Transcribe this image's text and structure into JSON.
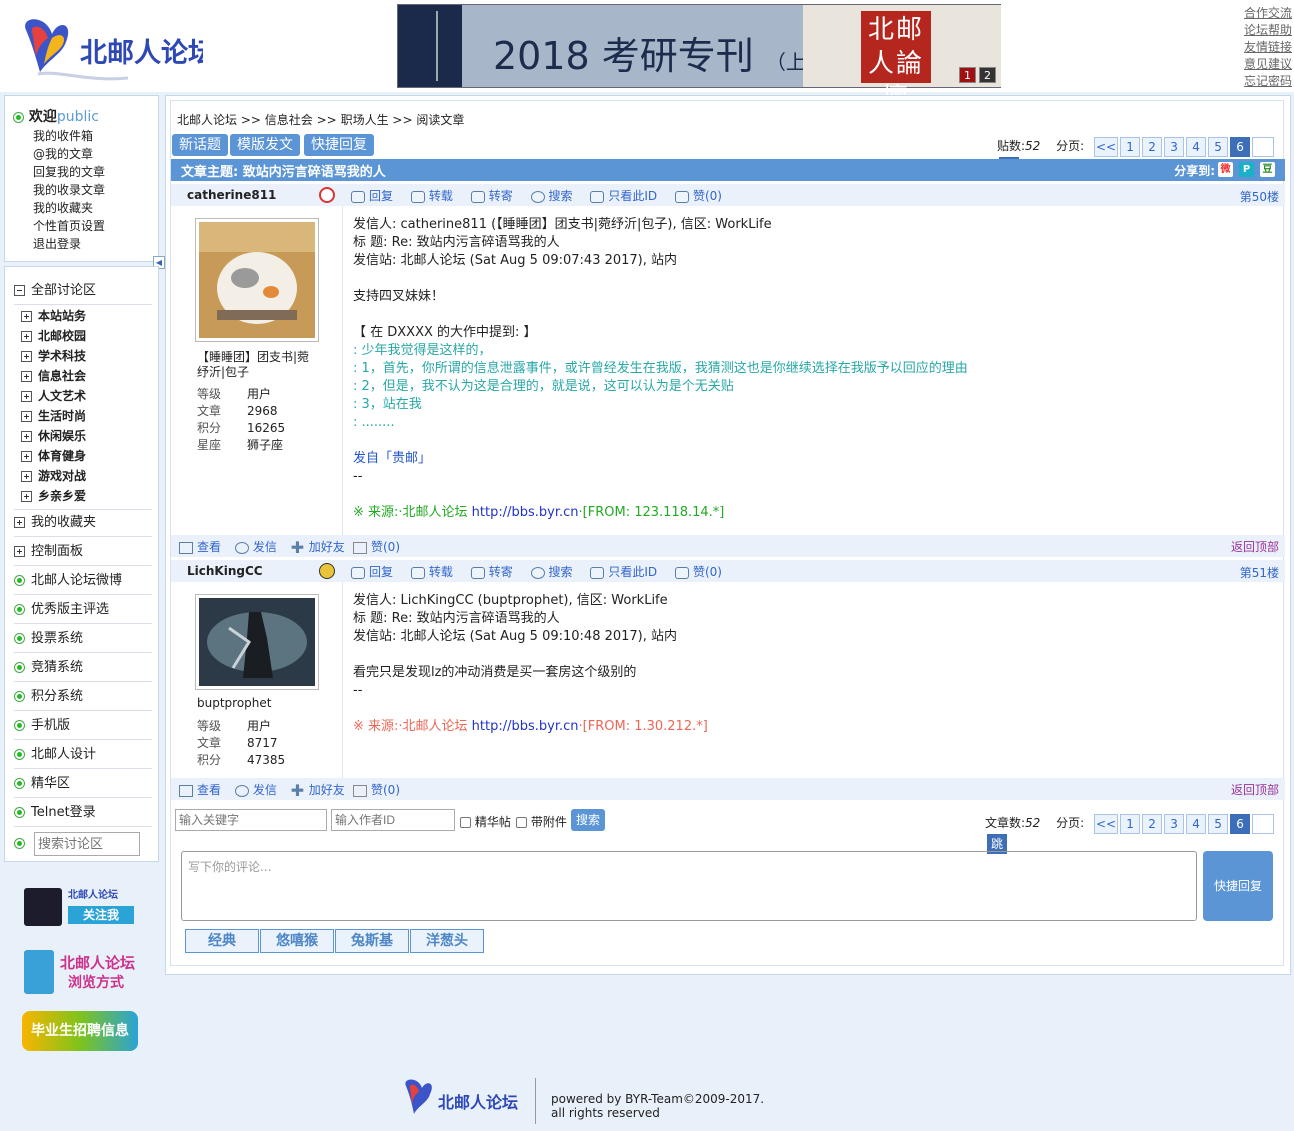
{
  "header": {
    "logo_text": "北邮人论坛",
    "banner": {
      "title": "2018 考研专刊",
      "subtitle": "（上）",
      "seal_text": "北邮人論壇",
      "pages": [
        "1",
        "2"
      ]
    },
    "links": [
      "合作交流",
      "论坛帮助",
      "友情链接",
      "意见建议",
      "忘记密码"
    ]
  },
  "welcome": {
    "greeting": "欢迎",
    "user": "public",
    "items": [
      "我的收件箱",
      "@我的文章",
      "回复我的文章",
      "我的收录文章",
      "我的收藏夹",
      "个性首页设置",
      "退出登录"
    ]
  },
  "nav": {
    "all_sections": "全部讨论区",
    "sections": [
      "本站站务",
      "北邮校园",
      "学术科技",
      "信息社会",
      "人文艺术",
      "生活时尚",
      "休闲娱乐",
      "体育健身",
      "游戏对战",
      "乡亲乡爱"
    ],
    "favorites": "我的收藏夹",
    "control": "控制面板",
    "links": [
      "北邮人论坛微博",
      "优秀版主评选",
      "投票系统",
      "竞猜系统",
      "积分系统",
      "手机版",
      "北邮人设计",
      "精华区",
      "Telnet登录"
    ],
    "search_placeholder": "搜索讨论区"
  },
  "badges": {
    "weibo": {
      "line1": "北邮人论坛",
      "line2": "关注我"
    },
    "browse": {
      "line1": "北邮人论坛",
      "line2": "浏览方式"
    },
    "jobs": "毕业生招聘信息"
  },
  "breadcrumb": [
    "北邮人论坛",
    ">>",
    "信息社会",
    ">>",
    "职场人生",
    ">>",
    "阅读文章"
  ],
  "toolbar": {
    "new_topic": "新话题",
    "template_post": "模版发文",
    "quick_reply": "快捷回复"
  },
  "pager_top": {
    "count_label": "贴数:",
    "count": "52",
    "page_label": "分页:",
    "pages": [
      "<<",
      "1",
      "2",
      "3",
      "4",
      "5",
      "6"
    ],
    "current": "6",
    "go": "跳"
  },
  "article": {
    "title_label": "文章主题:",
    "title": "致站内污言碎语骂我的人",
    "share_label": "分享到:"
  },
  "actions": {
    "reply": "回复",
    "forward": "转载",
    "mail": "转寄",
    "search": "搜索",
    "only_author": "只看此ID",
    "like": "赞(0)",
    "view": "查看",
    "message": "发信",
    "add_friend": "加好友",
    "back_top": "返回顶部"
  },
  "posts": [
    {
      "username": "catherine811",
      "floor": "第50楼",
      "nickname": "【睡睡团】团支书|菀纾沂|包子",
      "stats": [
        [
          "等级",
          "用户"
        ],
        [
          "文章",
          "2968"
        ],
        [
          "积分",
          "16265"
        ],
        [
          "星座",
          "狮子座"
        ]
      ],
      "lines": [
        "发信人: catherine811 (【睡睡团】团支书|菀纾沂|包子), 信区: WorkLife",
        "标  题: Re: 致站内污言碎语骂我的人",
        "发信站: 北邮人论坛 (Sat Aug  5 09:07:43 2017), 站内",
        "",
        "支持四叉妹妹！",
        "",
        "【 在 DXXXX 的大作中提到: 】"
      ],
      "quotes": [
        ": 少年我觉得是这样的，",
        ": 1，首先，你所谓的信息泄露事件，或许曾经发生在我版，我猜测这也是你继续选择在我版予以回应的理由",
        ": 2，但是，我不认为这是合理的，就是说，这可以认为是个无关贴",
        ": 3，站在我",
        ": ........"
      ],
      "sent_from": "发自「贵邮」",
      "sep": "--",
      "source_prefix": "※ 来源:·北邮人论坛 ",
      "source_url": "http://bbs.byr.cn",
      "source_from": "·[FROM: 123.118.14.*]",
      "source_color": "#22aa22"
    },
    {
      "username": "LichKingCC",
      "floor": "第51楼",
      "nickname": "buptprophet",
      "stats": [
        [
          "等级",
          "用户"
        ],
        [
          "文章",
          "8717"
        ],
        [
          "积分",
          "47385"
        ]
      ],
      "lines": [
        "发信人: LichKingCC (buptprophet), 信区: WorkLife",
        "标  题: Re: 致站内污言碎语骂我的人",
        "发信站: 北邮人论坛 (Sat Aug  5 09:10:48 2017), 站内",
        "",
        "看完只是发现lz的冲动消费是买一套房这个级别的",
        "--"
      ],
      "source_prefix": "※ 来源:·北邮人论坛 ",
      "source_url": "http://bbs.byr.cn",
      "source_from": "·[FROM: 1.30.212.*]",
      "source_color": "#ee6655"
    }
  ],
  "bottom": {
    "keyword_placeholder": "输入关键字",
    "author_placeholder": "输入作者ID",
    "digest": "精华帖",
    "attach": "带附件",
    "search": "搜索",
    "count_label": "文章数:",
    "count": "52",
    "page_label": "分页:",
    "comment_placeholder": "写下你的评论...",
    "quick_reply": "快捷回复",
    "emoticons": [
      "经典",
      "悠嘻猴",
      "兔斯基",
      "洋葱头"
    ]
  },
  "footer": {
    "logo_text": "北邮人论坛",
    "line1": "powered by BYR-Team©2009-2017.",
    "line2": "all rights reserved"
  }
}
